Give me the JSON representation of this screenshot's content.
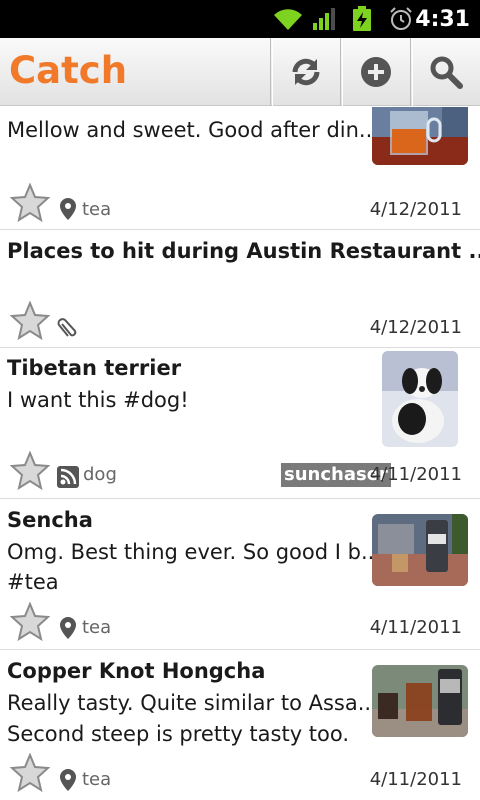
{
  "status_bar": {
    "time": "4:31",
    "icons": [
      "wifi-icon",
      "signal-icon",
      "battery-charging-icon",
      "alarm-icon"
    ]
  },
  "action_bar": {
    "title": "Catch",
    "title_color": "#f07a2a",
    "buttons": [
      "sync-icon",
      "add-icon",
      "search-icon"
    ]
  },
  "notes": [
    {
      "title": "",
      "text": [
        "Mellow and sweet. Good after din..."
      ],
      "tag": "tea",
      "meta_icon": "location-pin-icon",
      "user": "",
      "date": "4/12/2011",
      "thumb": "tea-photo"
    },
    {
      "title": "Places to hit during Austin Restaurant ...",
      "text": [],
      "tag": "",
      "meta_icon": "paperclip-icon",
      "user": "",
      "date": "4/12/2011",
      "thumb": ""
    },
    {
      "title": "Tibetan terrier",
      "text": [
        "I want this #dog!"
      ],
      "tag": "dog",
      "meta_icon": "rss-feed-icon",
      "user": "sunchaser",
      "date": "4/11/2011",
      "thumb": "dog-photo"
    },
    {
      "title": "Sencha",
      "text": [
        "Omg. Best thing ever. So good I b...",
        "#tea"
      ],
      "tag": "tea",
      "meta_icon": "location-pin-icon",
      "user": "",
      "date": "4/11/2011",
      "thumb": "tea-kettle-photo"
    },
    {
      "title": "Copper Knot Hongcha",
      "text": [
        "Really tasty. Quite similar to Assa...",
        "Second steep is pretty tasty too."
      ],
      "tag": "tea",
      "meta_icon": "location-pin-icon",
      "user": "",
      "date": "4/11/2011",
      "thumb": "tea-set-photo"
    }
  ]
}
